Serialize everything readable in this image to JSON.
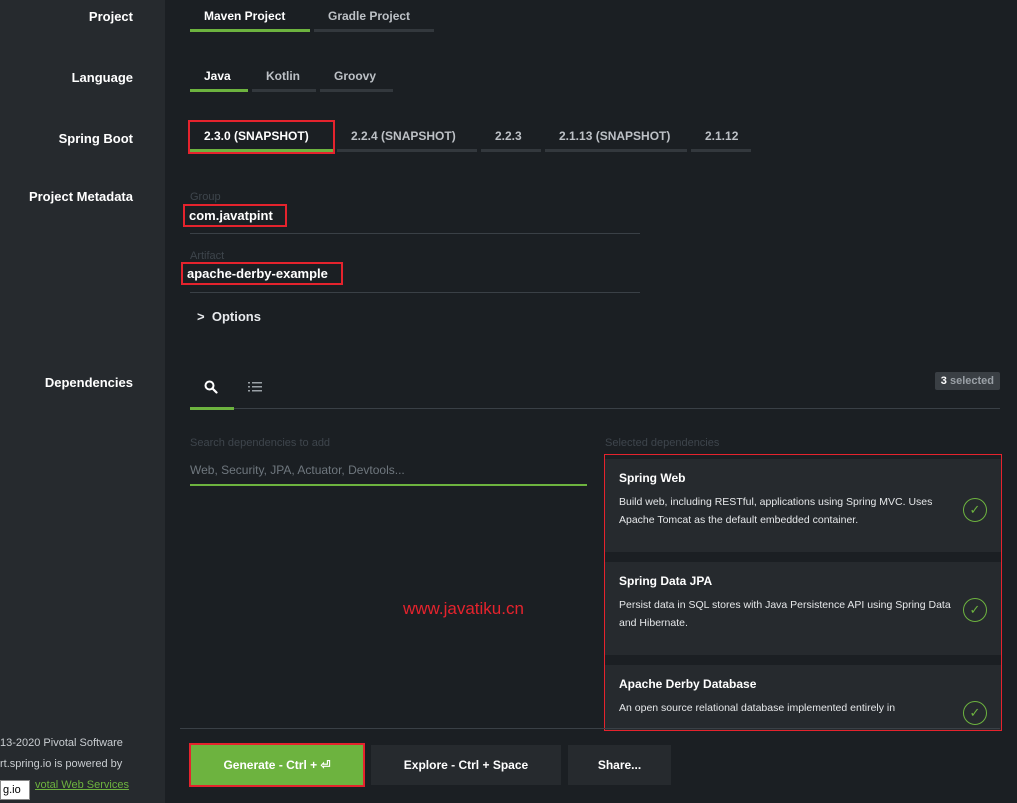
{
  "sections": {
    "project": "Project",
    "language": "Language",
    "spring_boot": "Spring Boot",
    "metadata": "Project Metadata",
    "dependencies": "Dependencies"
  },
  "project_options": [
    "Maven Project",
    "Gradle Project"
  ],
  "language_options": [
    "Java",
    "Kotlin",
    "Groovy"
  ],
  "boot_options": [
    "2.3.0 (SNAPSHOT)",
    "2.2.4 (SNAPSHOT)",
    "2.2.3",
    "2.1.13 (SNAPSHOT)",
    "2.1.12"
  ],
  "metadata": {
    "group_label": "Group",
    "group_value": "com.javatpint",
    "artifact_label": "Artifact",
    "artifact_value": "apache-derby-example",
    "options_label": "Options"
  },
  "deps": {
    "selected_count": "3",
    "selected_suffix": "selected",
    "search_label": "Search dependencies to add",
    "search_placeholder": "Web, Security, JPA, Actuator, Devtools...",
    "selected_label": "Selected dependencies",
    "items": [
      {
        "title": "Spring Web",
        "desc": "Build web, including RESTful, applications using Spring MVC. Uses Apache Tomcat as the default embedded container."
      },
      {
        "title": "Spring Data JPA",
        "desc": "Persist data in SQL stores with Java Persistence API using Spring Data and Hibernate."
      },
      {
        "title": "Apache Derby Database",
        "desc": "An open source relational database implemented entirely in"
      }
    ]
  },
  "footer": {
    "line1": "13-2020 Pivotal Software",
    "line2": "rt.spring.io is powered by",
    "link": "votal Web Services",
    "tooltip": "g.io"
  },
  "buttons": {
    "generate": "Generate - Ctrl + ⏎",
    "explore": "Explore - Ctrl + Space",
    "share": "Share..."
  },
  "watermark": "www.javatiku.cn",
  "colors": {
    "accent": "#6db33f",
    "highlight": "#e5232d",
    "background": "#1b1f23",
    "panel": "#262a2e"
  }
}
